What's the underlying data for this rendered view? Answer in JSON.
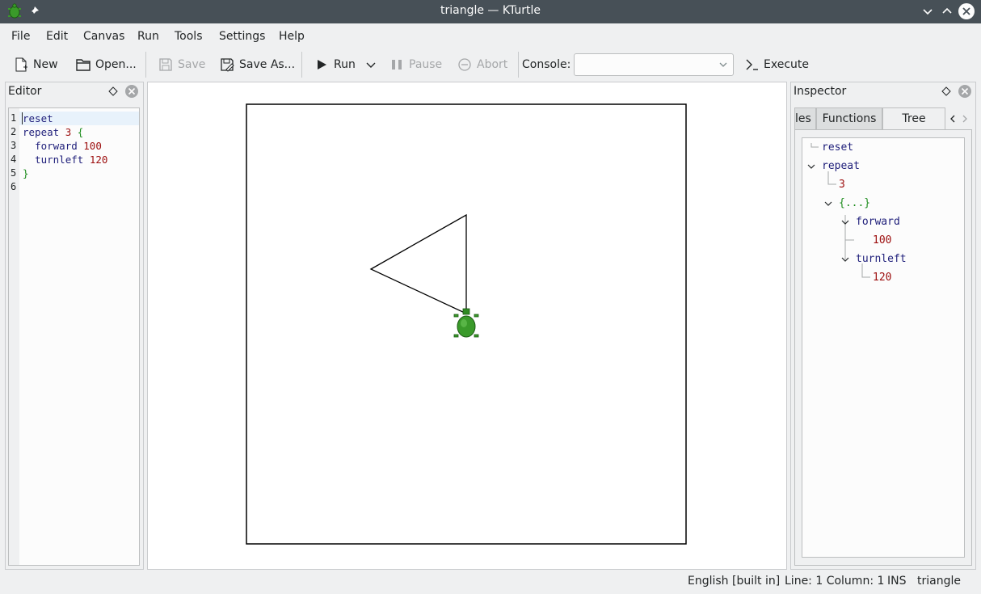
{
  "window": {
    "title": "triangle — KTurtle"
  },
  "menu": [
    "File",
    "Edit",
    "Canvas",
    "Run",
    "Tools",
    "Settings",
    "Help"
  ],
  "toolbar": {
    "new": "New",
    "open": "Open...",
    "save": "Save",
    "save_as": "Save As...",
    "run": "Run",
    "pause": "Pause",
    "abort": "Abort",
    "console_label": "Console:",
    "console_value": "",
    "execute": "Execute"
  },
  "editor": {
    "title": "Editor",
    "line_numbers": [
      "1",
      "2",
      "3",
      "4",
      "5",
      "6"
    ],
    "lines": [
      [
        {
          "t": "reset",
          "c": "kw"
        }
      ],
      [
        {
          "t": "repeat",
          "c": "kw"
        },
        {
          "t": " ",
          "c": ""
        },
        {
          "t": "3",
          "c": "num"
        },
        {
          "t": " ",
          "c": ""
        },
        {
          "t": "{",
          "c": "brace"
        }
      ],
      [
        {
          "t": "  ",
          "c": ""
        },
        {
          "t": "forward",
          "c": "kw"
        },
        {
          "t": " ",
          "c": ""
        },
        {
          "t": "100",
          "c": "num"
        }
      ],
      [
        {
          "t": "  ",
          "c": ""
        },
        {
          "t": "turnleft",
          "c": "kw"
        },
        {
          "t": " ",
          "c": ""
        },
        {
          "t": "120",
          "c": "num"
        }
      ],
      [
        {
          "t": "}",
          "c": "brace"
        }
      ],
      []
    ]
  },
  "inspector": {
    "title": "Inspector",
    "tabs": [
      "les",
      "Functions",
      "Tree"
    ],
    "active_tab": "Tree",
    "tree": {
      "reset": "reset",
      "repeat": "repeat",
      "repeat_count": "3",
      "block": "{...}",
      "forward": "forward",
      "forward_value": "100",
      "turnleft": "turnleft",
      "turnleft_value": "120"
    }
  },
  "status": {
    "language": "English [built in]",
    "position": "Line: 1 Column: 1",
    "mode": "INS",
    "file": "triangle"
  },
  "colors": {
    "titlebar": "#475057",
    "window_bg": "#eff0f1",
    "turtle": "#3a9a2a",
    "keyword": "#1e1e7a",
    "number": "#9c0d0d",
    "brace": "#1c8c1c"
  }
}
